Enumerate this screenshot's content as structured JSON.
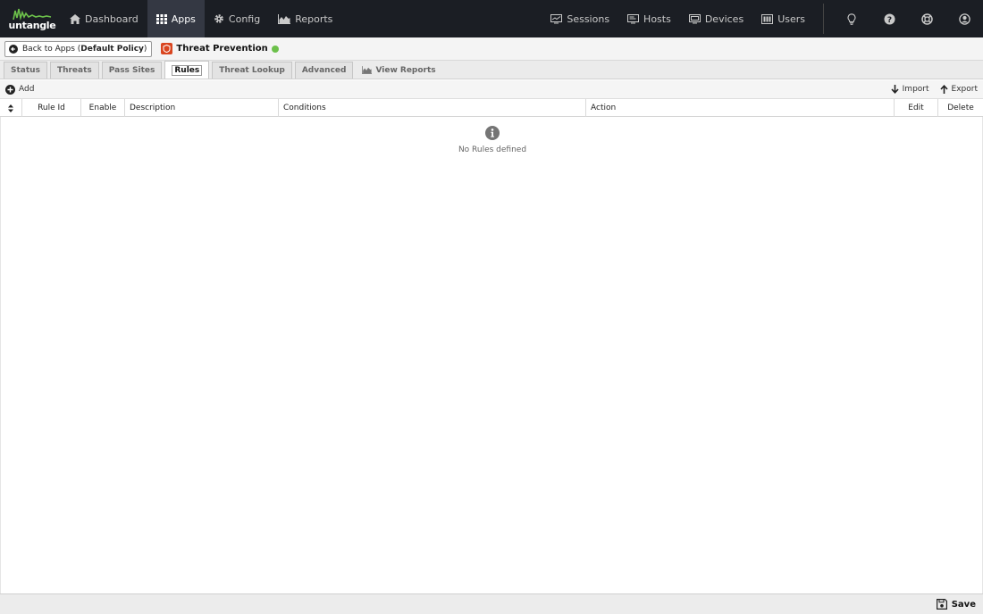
{
  "brand": {
    "logo_text": "untangle",
    "accent_color": "#6cc04a"
  },
  "topnav": {
    "left": [
      {
        "label": "Dashboard",
        "icon": "home-icon"
      },
      {
        "label": "Apps",
        "icon": "grid-icon",
        "active": true
      },
      {
        "label": "Config",
        "icon": "gear-icon"
      },
      {
        "label": "Reports",
        "icon": "area-chart-icon"
      }
    ],
    "right": [
      {
        "label": "Sessions",
        "icon": "sessions-icon"
      },
      {
        "label": "Hosts",
        "icon": "hosts-icon"
      },
      {
        "label": "Devices",
        "icon": "devices-icon"
      },
      {
        "label": "Users",
        "icon": "users-icon"
      }
    ],
    "icons": [
      "lightbulb-icon",
      "help-icon",
      "support-icon",
      "account-icon"
    ]
  },
  "breadcrumb": {
    "back_prefix": "Back to Apps (",
    "back_policy": "Default Policy",
    "back_suffix": ")",
    "app_title": "Threat Prevention",
    "status_color": "#6cc04a"
  },
  "tabs": [
    {
      "label": "Status"
    },
    {
      "label": "Threats"
    },
    {
      "label": "Pass Sites"
    },
    {
      "label": "Rules",
      "active": true
    },
    {
      "label": "Threat Lookup"
    },
    {
      "label": "Advanced"
    },
    {
      "label": "View Reports"
    }
  ],
  "toolbar": {
    "add_label": "Add",
    "import_label": "Import",
    "export_label": "Export"
  },
  "grid": {
    "columns": [
      "Rule Id",
      "Enable",
      "Description",
      "Conditions",
      "Action",
      "Edit",
      "Delete"
    ],
    "empty_text": "No Rules defined"
  },
  "footer": {
    "save_label": "Save"
  }
}
